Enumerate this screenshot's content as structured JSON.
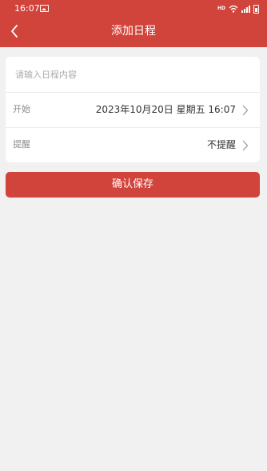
{
  "status_bar": {
    "time": "16:07",
    "network_label": "HD"
  },
  "header": {
    "title": "添加日程"
  },
  "form": {
    "content_placeholder": "请输入日程内容",
    "content_value": "",
    "start_label": "开始",
    "start_value": "2023年10月20日 星期五  16:07",
    "remind_label": "提醒",
    "remind_value": "不提醒"
  },
  "save_button": {
    "label": "确认保存"
  },
  "colors": {
    "accent": "#d1443b",
    "background": "#f1f1f1"
  }
}
